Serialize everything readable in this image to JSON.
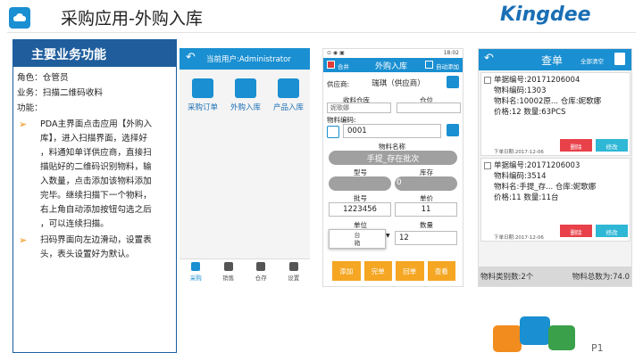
{
  "header": {
    "title": "采购应用-外购入库",
    "brand": "Kingdee"
  },
  "left_panel": {
    "title": "主要业务功能",
    "role": "角色：仓管员",
    "business": "业务：扫描二维码收料",
    "function_label": "功能：",
    "bullets": [
      [
        "PDA主界面点击应用【外购入",
        "库】，进入扫描界面，选择好",
        "，料通知单详供应商，直接扫",
        "描贴好的二维码识别物料，输",
        "入数量，点击添加该物料添加",
        "完毕。继续扫描下一个物料，",
        "右上角自动添加按钮勾选之后",
        "，可以连续扫描。"
      ],
      [
        "扫码界面向左边滑动，设置表",
        "头，表头设置好为默认。"
      ]
    ]
  },
  "phone1": {
    "current_user": "当前用户:Administrator",
    "tiles": [
      "采购订单",
      "外购入库",
      "产品入库"
    ],
    "tabs": [
      "采购",
      "销售",
      "仓存",
      "设置"
    ]
  },
  "phone2": {
    "time": "18:02",
    "merge_label": "合并",
    "title": "外购入库",
    "auto_add_label": "自动添加",
    "supplier_label": "供应商:",
    "supplier_value": "瑞琪（供应商）",
    "receive_wh_label": "收料仓库",
    "location_label": "仓位",
    "receive_wh_value": "妮歌娜",
    "material_code_label": "物料编码:",
    "material_code_value": "0001",
    "material_name_label": "物料名称",
    "material_name_value": "手提_存在批次",
    "model_label": "型号",
    "stock_label": "库存",
    "stock_value": "0",
    "batch_label": "批号",
    "unit_price_label": "单价",
    "batch_value": "1223456",
    "unit_price_value": "11",
    "unit_label": "单位",
    "qty_label": "数量",
    "unit_value": "台\n箱",
    "qty_value": "12",
    "actions": [
      "添加",
      "完单",
      "回单",
      "查看"
    ]
  },
  "phone3": {
    "title": "查单",
    "clear_all": "全部清空",
    "cards": [
      {
        "lines": [
          "单据编号:20171206004",
          "物料编码:1303",
          "物料名:10002原... 仓库:妮歌娜",
          "价格:12 数量:63PCS"
        ],
        "date": "下单日期:2017-12-06",
        "delete": "删除",
        "edit": "修改"
      },
      {
        "lines": [
          "单据编号:20171206003",
          "物料编码:3514",
          "物料名:手提_存... 仓库:妮歌娜",
          "价格:11 数量:11台"
        ],
        "date": "下单日期:2017-12-06",
        "delete": "删除",
        "edit": "修改"
      }
    ],
    "footer_left": "物料类别数:2个",
    "footer_right": "物料总数为:74.0"
  },
  "page_number": "P1"
}
